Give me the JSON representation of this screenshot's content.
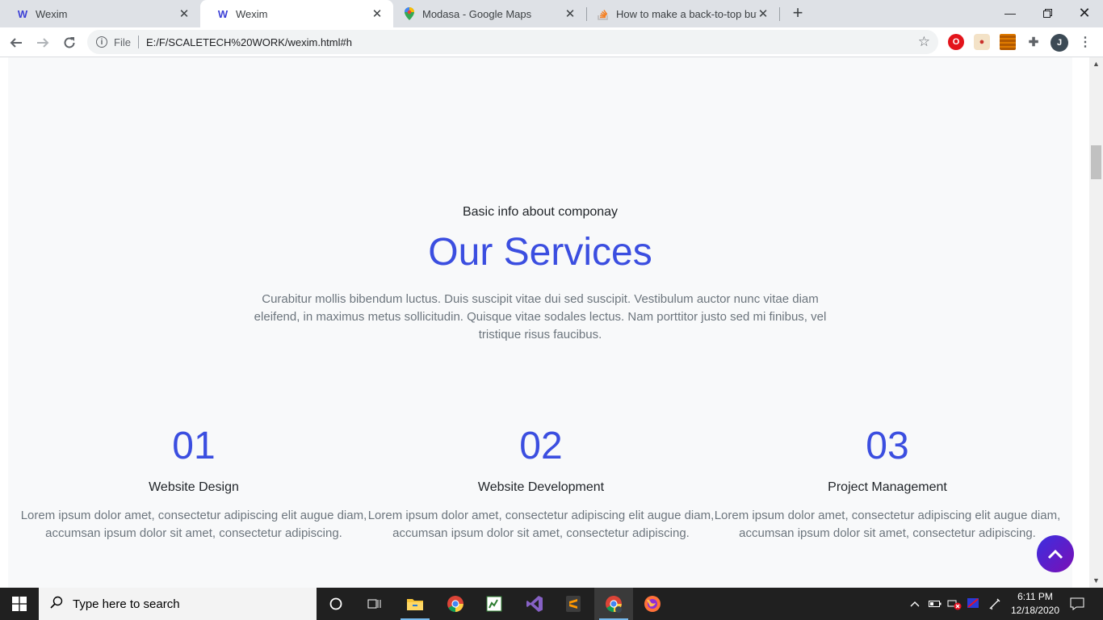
{
  "browser": {
    "tabs": [
      {
        "title": "Wexim",
        "favicon": "wexim-logo-icon",
        "active": false
      },
      {
        "title": "Wexim",
        "favicon": "wexim-logo-icon",
        "active": true
      },
      {
        "title": "Modasa - Google Maps",
        "favicon": "google-maps-pin-icon",
        "active": false
      },
      {
        "title": "How to make a back-to-top butt",
        "favicon": "stack-overflow-icon",
        "active": false
      }
    ],
    "omnibox": {
      "scheme_label": "File",
      "url": "E:/F/SCALETECH%20WORK/wexim.html#h"
    },
    "profile_initial": "J"
  },
  "page": {
    "subtitle": "Basic info about componay",
    "heading": "Our Services",
    "lead": "Curabitur mollis bibendum luctus. Duis suscipit vitae dui sed suscipit. Vestibulum auctor nunc vitae diam eleifend, in maximus metus sollicitudin. Quisque vitae sodales lectus. Nam porttitor justo sed mi finibus, vel tristique risus faucibus.",
    "services": [
      {
        "number": "01",
        "name": "Website Design",
        "description": "Lorem ipsum dolor amet, consectetur adipiscing elit augue diam, accumsan ipsum dolor sit amet, consectetur adipiscing."
      },
      {
        "number": "02",
        "name": "Website Development",
        "description": "Lorem ipsum dolor amet, consectetur adipiscing elit augue diam, accumsan ipsum dolor sit amet, consectetur adipiscing."
      },
      {
        "number": "03",
        "name": "Project Management",
        "description": "Lorem ipsum dolor amet, consectetur adipiscing elit augue diam, accumsan ipsum dolor sit amet, consectetur adipiscing."
      }
    ],
    "accent_color": "#3b4ee0"
  },
  "taskbar": {
    "search_placeholder": "Type here to search",
    "time": "6:11 PM",
    "date": "12/18/2020"
  }
}
